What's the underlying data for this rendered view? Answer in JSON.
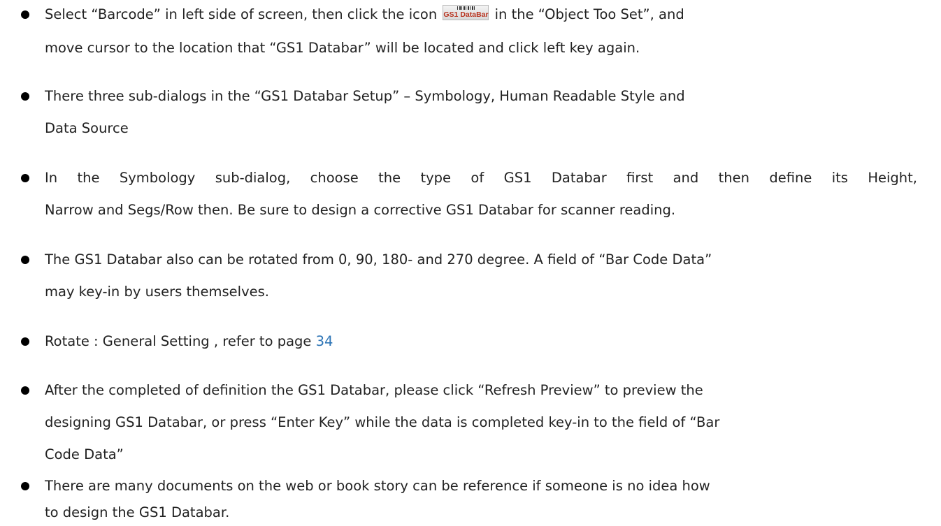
{
  "bullets": [
    {
      "lines": [
        "Select “Barcode” in left side of screen, then click the icon",
        "in the “Object Too Set”, and",
        "move cursor to the location that “GS1 Databar” will be located and click left key again."
      ]
    },
    {
      "lines": [
        "There three sub-dialogs in the “GS1 Databar Setup” – Symbology, Human Readable Style and",
        "Data Source"
      ]
    },
    {
      "lines": [
        "In the Symbology sub-dialog, choose the type of GS1 Databar first and then define its Height,",
        "Narrow and Segs/Row then. Be sure to design a corrective GS1 Databar for scanner reading."
      ]
    },
    {
      "lines": [
        "The GS1 Databar also can be rotated from 0, 90, 180- and 270 degree. A field of “Bar Code Data”",
        "may key-in by users themselves."
      ]
    },
    {
      "lines": [
        "Rotate : General Setting , refer to page"
      ],
      "link_text": "34"
    },
    {
      "lines": [
        "After the completed of definition the GS1 Databar, please click “Refresh Preview” to preview the",
        "designing GS1 Databar, or press “Enter Key” while the data is completed key-in to the field of “Bar",
        "Code Data”"
      ]
    },
    {
      "lines": [
        "There are many documents on the web or book story can be reference if someone is no idea how",
        "to design the GS1 Databar."
      ]
    }
  ],
  "icon": {
    "name": "gs1-databar-icon",
    "text": "GS1 DataBar"
  },
  "colors": {
    "link": "#2e75b6",
    "icon_text": "#b8321e"
  }
}
